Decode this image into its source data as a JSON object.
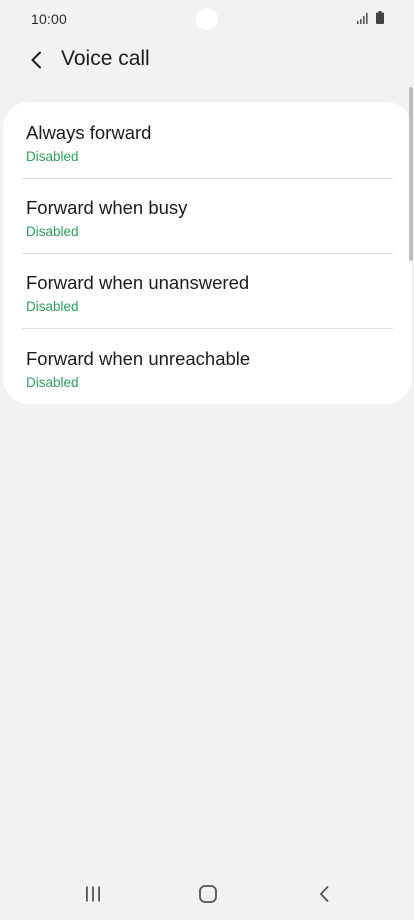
{
  "status_bar": {
    "time": "10:00"
  },
  "header": {
    "title": "Voice call",
    "back_icon": "chevron-left-icon"
  },
  "forward_options": [
    {
      "title": "Always forward",
      "status": "Disabled"
    },
    {
      "title": "Forward when busy",
      "status": "Disabled"
    },
    {
      "title": "Forward when unanswered",
      "status": "Disabled"
    },
    {
      "title": "Forward when unreachable",
      "status": "Disabled"
    }
  ],
  "navigation_bar": {
    "icons": [
      "recent-apps-icon",
      "home-icon",
      "back-icon"
    ]
  },
  "colors": {
    "background": "#f2f2f2",
    "card": "#ffffff",
    "status_text": "#2e9e5c",
    "primary_text": "#1c1c1c"
  }
}
